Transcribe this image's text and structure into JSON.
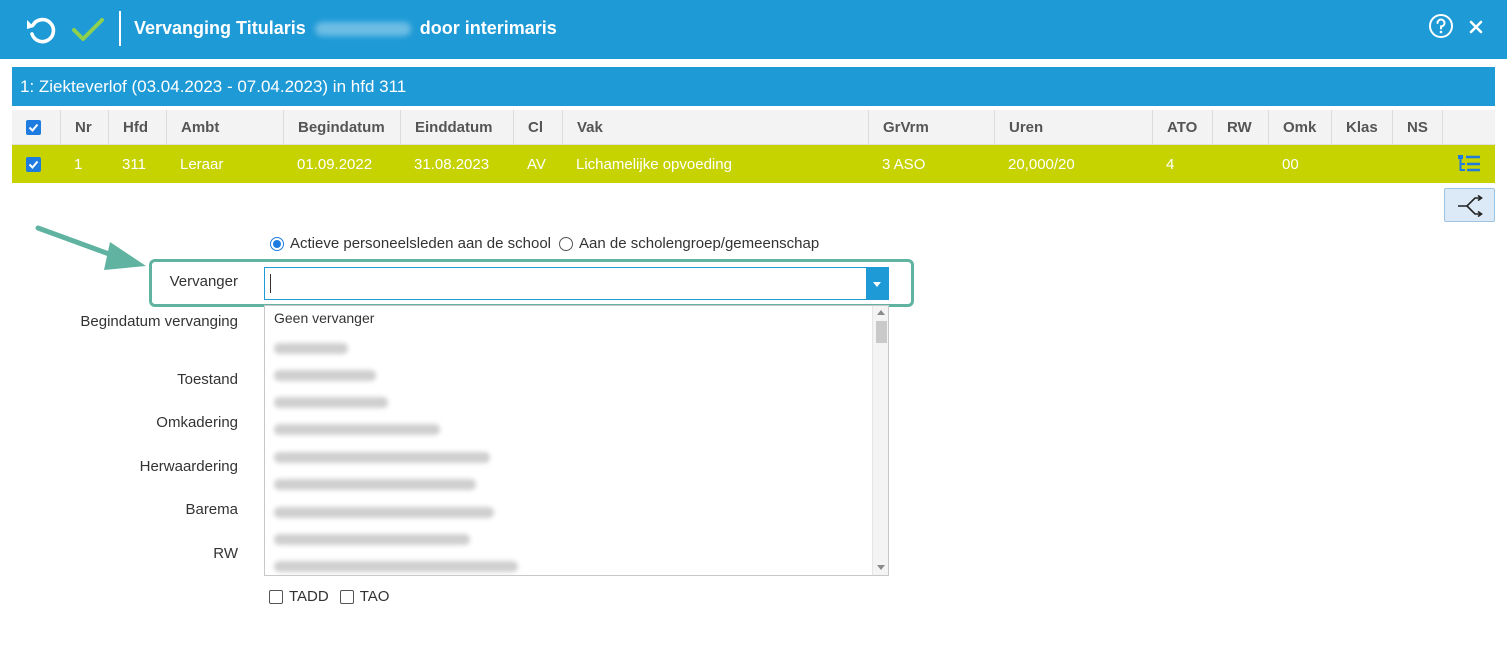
{
  "header": {
    "title_prefix": "Vervanging Titularis",
    "title_suffix": "door interimaris",
    "colors": {
      "bar": "#1e9ad6",
      "check": "#8fd14f"
    },
    "icons": [
      "undo-icon",
      "check-icon",
      "help-icon",
      "close-icon"
    ]
  },
  "absence": {
    "heading": "1: Ziekteverlof (03.04.2023 - 07.04.2023) in hfd 311",
    "columns": [
      "Nr",
      "Hfd",
      "Ambt",
      "Begindatum",
      "Einddatum",
      "Cl",
      "Vak",
      "GrVrm",
      "Uren",
      "ATO",
      "RW",
      "Omk",
      "Klas",
      "NS"
    ],
    "row": {
      "nr": "1",
      "hfd": "311",
      "ambt": "Leraar",
      "begindatum": "01.09.2022",
      "einddatum": "31.08.2023",
      "cl": "AV",
      "vak": "Lichamelijke opvoeding",
      "grvrm": "3 ASO",
      "uren": "20,000/20",
      "ato": "4",
      "rw": "",
      "omk": "00",
      "klas": "",
      "ns": ""
    },
    "row_color": "#c6d300"
  },
  "form": {
    "radio_active_label": "Actieve personeelsleden aan de school",
    "radio_group_label": "Aan de scholengroep/gemeenschap",
    "vervanger_label": "Vervanger",
    "vervanger_value": "",
    "begindatum_label": "Begindatum vervanging",
    "toestand_label": "Toestand",
    "omkadering_label": "Omkadering",
    "herwaardering_label": "Herwaardering",
    "barema_label": "Barema",
    "rw_label": "RW",
    "dropdown_first_option": "Geen vervanger",
    "tadd_label": "TADD",
    "tao_label": "TAO",
    "highlight_color": "#5fb3a0"
  }
}
